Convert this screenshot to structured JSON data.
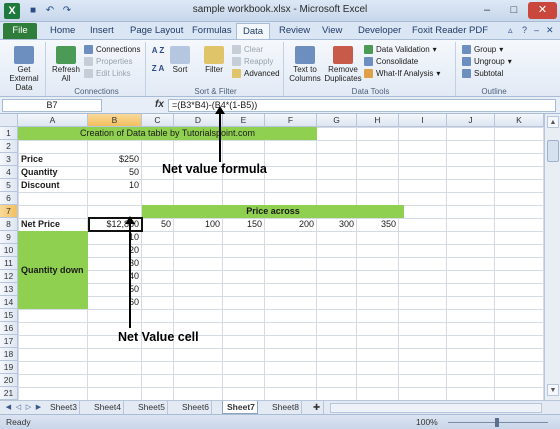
{
  "window": {
    "title": "sample workbook.xlsx - Microsoft Excel",
    "app_icon": "X",
    "quick_access": [
      "save-icon",
      "undo-icon",
      "redo-icon"
    ],
    "controls": {
      "minimize": "–",
      "maximize": "□",
      "close": "✕"
    }
  },
  "tabs": [
    {
      "label": "File"
    },
    {
      "label": "Home"
    },
    {
      "label": "Insert"
    },
    {
      "label": "Page Layout"
    },
    {
      "label": "Formulas"
    },
    {
      "label": "Data"
    },
    {
      "label": "Review"
    },
    {
      "label": "View"
    },
    {
      "label": "Developer"
    },
    {
      "label": "Foxit Reader PDF"
    }
  ],
  "active_tab": "Data",
  "ribbon": {
    "get_external_data": "Get External Data",
    "connections_group": {
      "label": "Connections",
      "refresh_all": "Refresh All",
      "connections": "Connections",
      "properties": "Properties",
      "edit_links": "Edit Links"
    },
    "sort_filter_group": {
      "label": "Sort & Filter",
      "sort": "Sort",
      "filter": "Filter",
      "clear": "Clear",
      "reapply": "Reapply",
      "advanced": "Advanced",
      "az": "A Z",
      "za": "Z A"
    },
    "data_tools_group": {
      "label": "Data Tools",
      "text_to_columns": "Text to Columns",
      "remove_duplicates": "Remove Duplicates",
      "data_validation": "Data Validation",
      "consolidate": "Consolidate",
      "what_if": "What-If Analysis"
    },
    "outline_group": {
      "label": "Outline",
      "group": "Group",
      "ungroup": "Ungroup",
      "subtotal": "Subtotal"
    }
  },
  "formula_bar": {
    "name_box": "B7",
    "fx": "fx",
    "formula": "=(B3*B4)-(B4*(1-B5))"
  },
  "columns": [
    "A",
    "B",
    "C",
    "D",
    "E",
    "F",
    "G",
    "H",
    "I",
    "J",
    "K"
  ],
  "rows": [
    "1",
    "2",
    "3",
    "4",
    "5",
    "6",
    "7",
    "8",
    "9",
    "10",
    "11",
    "12",
    "13",
    "14",
    "15",
    "16",
    "17",
    "18",
    "19",
    "20",
    "21"
  ],
  "sheet": {
    "title": "Creation of Data table by Tutorialspoint.com",
    "price_label": "Price",
    "price_value": "$250",
    "quantity_label": "Quantity",
    "quantity_value": "50",
    "discount_label": "Discount",
    "discount_value": "10",
    "price_across": "Price across",
    "net_price_label": "Net Price",
    "net_price_value": "$12,850",
    "prices": [
      "50",
      "100",
      "150",
      "200",
      "300",
      "350"
    ],
    "quantity_down": "Quantity down",
    "quantities": [
      "10",
      "20",
      "30",
      "40",
      "50",
      "60"
    ]
  },
  "annotations": {
    "formula_note": "Net value formula",
    "cell_note": "Net Value cell"
  },
  "sheet_tabs": [
    "Sheet3",
    "Sheet4",
    "Sheet5",
    "Sheet6",
    "Sheet7",
    "Sheet8"
  ],
  "active_sheet": "Sheet7",
  "status": {
    "ready": "Ready",
    "zoom": "100%"
  },
  "colors": {
    "green_fill": "#8fd050",
    "file_tab": "#2f7d3a"
  }
}
